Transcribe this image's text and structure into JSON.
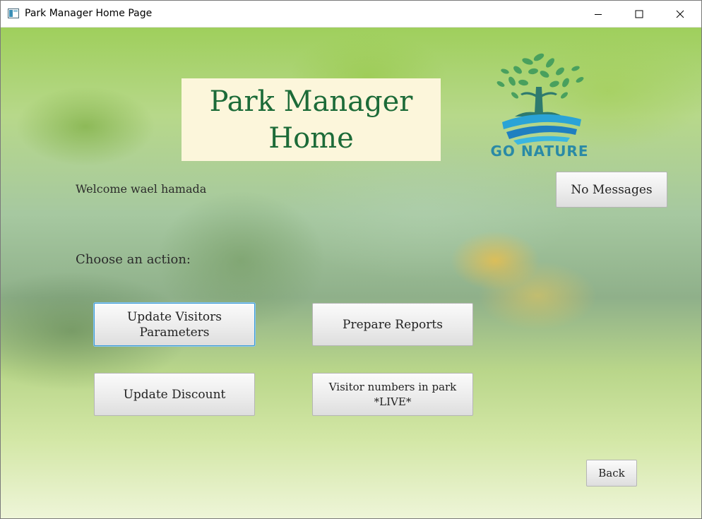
{
  "window": {
    "title": "Park Manager Home Page",
    "icon": "app-window-icon",
    "controls": [
      "minimize-icon",
      "maximize-icon",
      "close-icon"
    ]
  },
  "header": {
    "title_line1": "Park Manager",
    "title_line2": "Home",
    "title_color": "#1c6b38",
    "title_bg": "#fcf6db"
  },
  "logo": {
    "text": "GO NATURE",
    "icon": "tree-river-logo",
    "color": "#2a8aa6"
  },
  "welcome_text": "Welcome wael hamada",
  "choose_text": "Choose an action:",
  "buttons": {
    "messages": "No Messages",
    "update_visitors": "Update Visitors\nParameters",
    "prepare_reports": "Prepare Reports",
    "update_discount": "Update Discount",
    "visitor_numbers_live": "Visitor numbers in park\n*LIVE*",
    "back": "Back"
  },
  "colors": {
    "focus_border": "#3b9ad6"
  }
}
